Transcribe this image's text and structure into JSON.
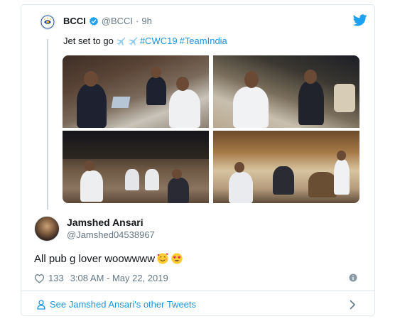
{
  "parent_tweet": {
    "display_name": "BCCI",
    "handle": "@BCCI",
    "separator": "·",
    "time": "9h",
    "text_prefix": "Jet set to go",
    "hashtags": [
      "#CWC19",
      "#TeamIndia"
    ],
    "icons": [
      "verified-badge-icon",
      "airplane-icon",
      "airplane-icon",
      "twitter-bird-icon"
    ],
    "photo_count": 4
  },
  "reply_tweet": {
    "display_name": "Jamshed Ansari",
    "handle": "@Jamshed04538967",
    "text": "All pub g lover woowwww",
    "emojis": [
      "smiling-face-with-hearts-emoji",
      "heart-eyes-emoji"
    ],
    "like_count": "133",
    "timestamp": "3:08 AM - May 22, 2019"
  },
  "footer": {
    "link_label": "See Jamshed Ansari's other Tweets"
  },
  "colors": {
    "link": "#1b95e0",
    "secondary_text": "#657786",
    "border": "#e1e8ed"
  }
}
